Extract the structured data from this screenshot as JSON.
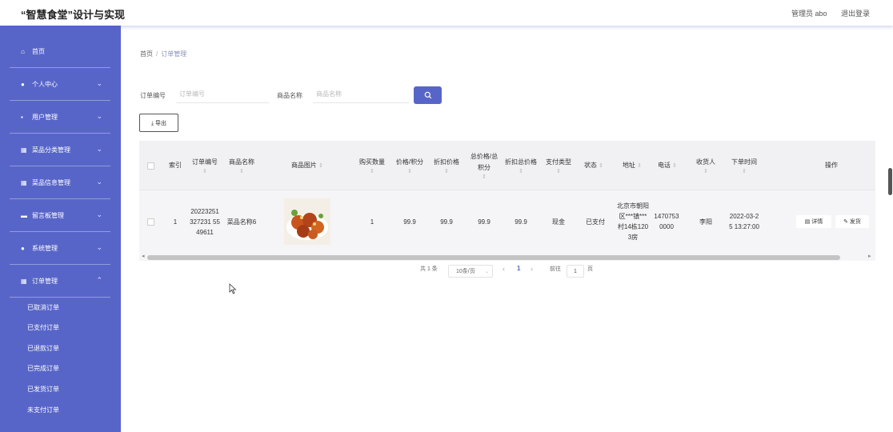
{
  "header": {
    "app_title": "“智慧食堂”设计与实现",
    "admin_label": "管理员 abo",
    "logout_label": "退出登录"
  },
  "sidebar": {
    "items": [
      {
        "label": "首页",
        "icon": "home-icon"
      },
      {
        "label": "个人中心",
        "icon": "user-icon"
      },
      {
        "label": "用户管理",
        "icon": "users-icon"
      },
      {
        "label": "菜品分类管理",
        "icon": "grid-icon"
      },
      {
        "label": "菜品信息管理",
        "icon": "grid-icon"
      },
      {
        "label": "留言板管理",
        "icon": "board-icon"
      },
      {
        "label": "系统管理",
        "icon": "user-icon"
      },
      {
        "label": "订单管理",
        "icon": "grid-icon"
      }
    ],
    "submenu": [
      "已取消订单",
      "已支付订单",
      "已退款订单",
      "已完成订单",
      "已发货订单",
      "未支付订单"
    ]
  },
  "breadcrumb": {
    "home": "首页",
    "separator": "/",
    "current": "订单管理"
  },
  "search": {
    "order_no_label": "订单编号",
    "order_no_placeholder": "订单编号",
    "product_name_label": "商品名称",
    "product_name_placeholder": "商品名称"
  },
  "toolbar": {
    "export_label": "⤓ 导出"
  },
  "table": {
    "headers": [
      "索引",
      "订单编号",
      "商品名称",
      "商品图片",
      "购买数量",
      "价格/积分",
      "折扣价格",
      "总价格/总积分",
      "折扣总价格",
      "支付类型",
      "状态",
      "地址",
      "电话",
      "收货人",
      "下单时间",
      "操作"
    ],
    "rows": [
      {
        "index": "1",
        "order_no": "20223251327231 5549611",
        "product_name": "菜品名称6",
        "quantity": "1",
        "price": "99.9",
        "discount_price": "99.9",
        "total_price": "99.9",
        "discount_total": "99.9",
        "pay_type": "现金",
        "status": "已支付",
        "address": "北京市朝阳区***镇***村14栋1203房",
        "phone": "14707530000",
        "receiver": "李阳",
        "order_time": "2022-03-25 13:27:00",
        "detail_label": "详情",
        "edit_label": "发货"
      }
    ]
  },
  "pagination": {
    "total": "共 1 条",
    "page_size": "10条/页",
    "current_page": "1",
    "goto_label": "前往",
    "goto_value": "1",
    "page_suffix": "页"
  },
  "colors": {
    "sidebar_bg": "#5865c8",
    "accent": "#5865c8"
  }
}
